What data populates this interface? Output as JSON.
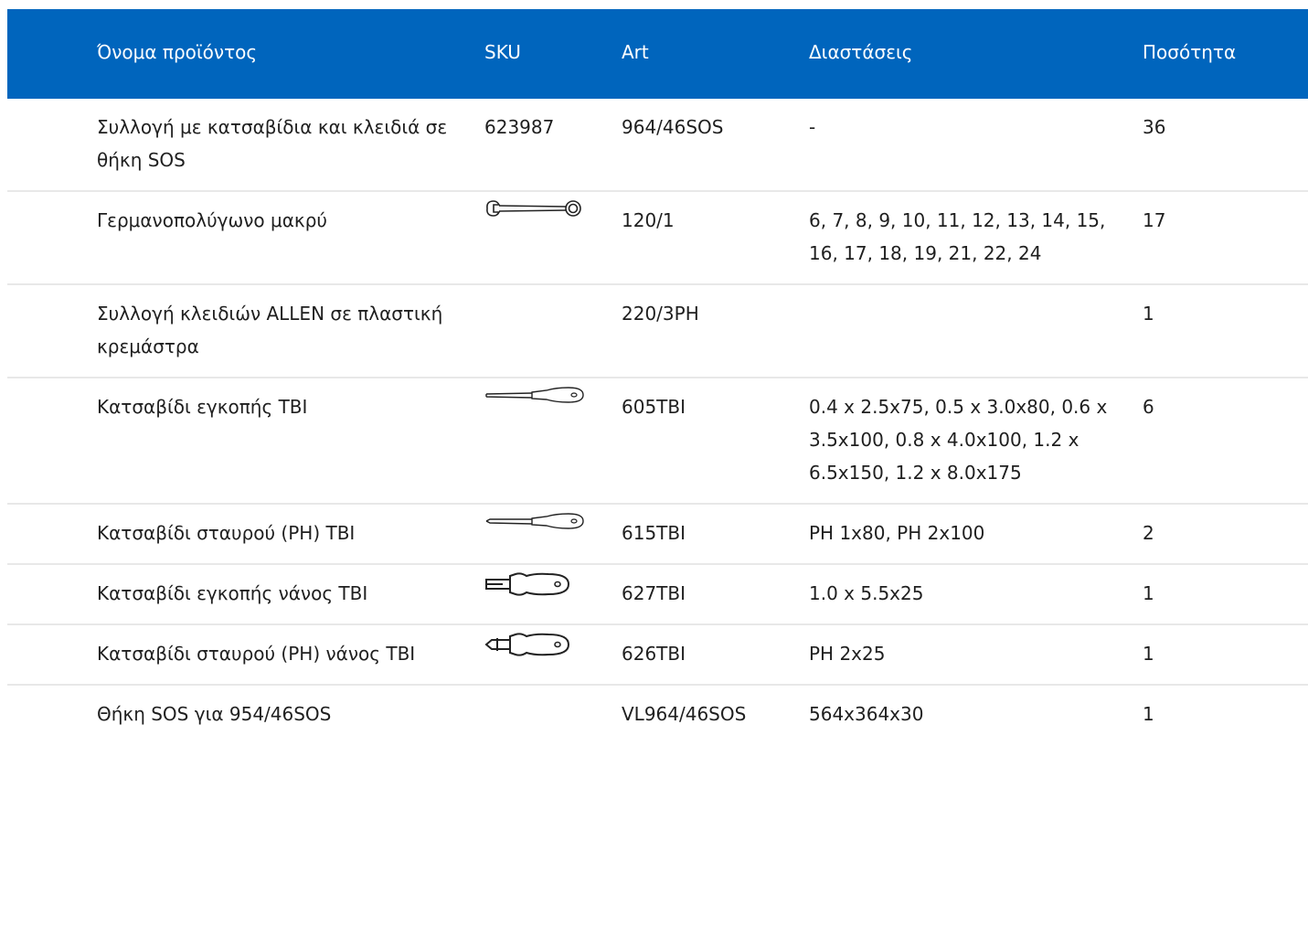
{
  "table": {
    "headers": {
      "name": "Όνομα προϊόντος",
      "sku": "SKU",
      "art": "Art",
      "dimensions": "Διαστάσεις",
      "quantity": "Ποσότητα"
    },
    "rows": [
      {
        "name": "Συλλογή με κατσαβίδια και κλειδιά σε θήκη SOS",
        "sku": "623987",
        "art": "964/46SOS",
        "dimensions": "-",
        "quantity": "36",
        "icon": ""
      },
      {
        "name": "Γερμανοπολύγωνο μακρύ",
        "sku": "",
        "art": "120/1",
        "dimensions": "6, 7, 8, 9, 10, 11, 12, 13, 14, 15, 16, 17, 18, 19, 21, 22, 24",
        "quantity": "17",
        "icon": "combination-wrench-icon"
      },
      {
        "name": "Συλλογή κλειδιών ALLEN σε πλαστική κρεμάστρα",
        "sku": "",
        "art": "220/3PH",
        "dimensions": "",
        "quantity": "1",
        "icon": ""
      },
      {
        "name": "Κατσαβίδι εγκοπής TBI",
        "sku": "",
        "art": "605TBI",
        "dimensions": "0.4 x 2.5x75, 0.5 x 3.0x80, 0.6 x 3.5x100, 0.8 x 4.0x100, 1.2 x 6.5x150, 1.2 x 8.0x175",
        "quantity": "6",
        "icon": "slotted-screwdriver-icon"
      },
      {
        "name": "Κατσαβίδι σταυρού (PH) TBI",
        "sku": "",
        "art": "615TBI",
        "dimensions": "PH 1x80, PH 2x100",
        "quantity": "2",
        "icon": "phillips-screwdriver-icon"
      },
      {
        "name": "Κατσαβίδι εγκοπής νάνος TBI",
        "sku": "",
        "art": "627TBI",
        "dimensions": "1.0 x 5.5x25",
        "quantity": "1",
        "icon": "stubby-slotted-screwdriver-icon"
      },
      {
        "name": "Κατσαβίδι σταυρού (PH) νάνος TBI",
        "sku": "",
        "art": "626TBI",
        "dimensions": "PH 2x25",
        "quantity": "1",
        "icon": "stubby-phillips-screwdriver-icon"
      },
      {
        "name": "Θήκη SOS για 954/46SOS",
        "sku": "",
        "art": "VL964/46SOS",
        "dimensions": "564x364x30",
        "quantity": "1",
        "icon": ""
      }
    ]
  },
  "colors": {
    "header_bg": "#0065bd",
    "header_text": "#ffffff",
    "row_divider": "#e8e8e8"
  }
}
